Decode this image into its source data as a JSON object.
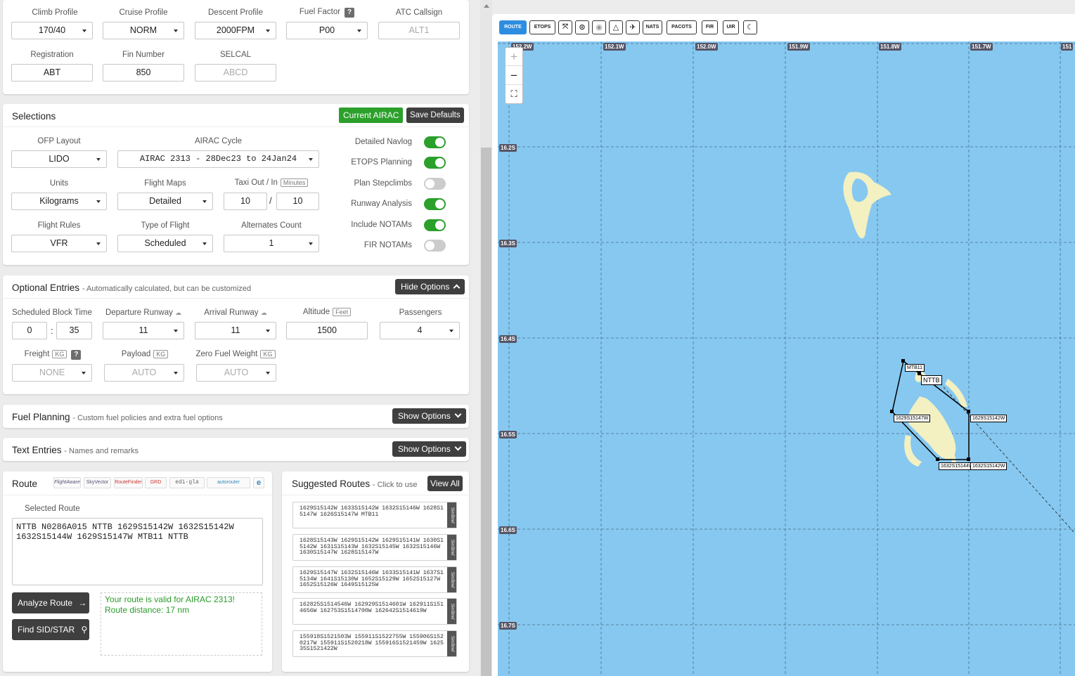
{
  "top": {
    "climb_label": "Climb Profile",
    "climb": "170/40",
    "cruise_label": "Cruise Profile",
    "cruise": "NORM",
    "descent_label": "Descent Profile",
    "descent": "2000FPM",
    "fuel_label": "Fuel Factor",
    "fuel_help": "?",
    "fuel": "P00",
    "atc_label": "ATC Callsign",
    "atc_placeholder": "ALT1",
    "reg_label": "Registration",
    "reg": "ABT",
    "fin_label": "Fin Number",
    "fin": "850",
    "selcal_label": "SELCAL",
    "selcal_placeholder": "ABCD"
  },
  "selections": {
    "title": "Selections",
    "current_airac": "Current AIRAC",
    "save_defaults": "Save Defaults",
    "ofp_label": "OFP Layout",
    "ofp": "LIDO",
    "airac_label": "AIRAC Cycle",
    "airac": "AIRAC 2313 - 28Dec23 to 24Jan24",
    "units_label": "Units",
    "units": "Kilograms",
    "maps_label": "Flight Maps",
    "maps": "Detailed",
    "taxi_label": "Taxi Out / In",
    "taxi_unit": "Minutes",
    "taxi_out": "10",
    "taxi_sep": "/",
    "taxi_in": "10",
    "rules_label": "Flight Rules",
    "rules": "VFR",
    "type_label": "Type of Flight",
    "type": "Scheduled",
    "alt_label": "Alternates Count",
    "alt": "1",
    "toggles": [
      {
        "label": "Detailed Navlog",
        "on": true
      },
      {
        "label": "ETOPS Planning",
        "on": true
      },
      {
        "label": "Plan Stepclimbs",
        "on": false
      },
      {
        "label": "Runway Analysis",
        "on": true
      },
      {
        "label": "Include NOTAMs",
        "on": true
      },
      {
        "label": "FIR NOTAMs",
        "on": false
      }
    ]
  },
  "optional": {
    "title": "Optional Entries",
    "subtitle": "- Automatically calculated, but can be customized",
    "hide_btn": "Hide Options",
    "block_label": "Scheduled Block Time",
    "block_h": "0",
    "block_sep": ":",
    "block_m": "35",
    "dep_label": "Departure Runway",
    "dep": "11",
    "arr_label": "Arrival Runway",
    "arr": "11",
    "altitude_label": "Altitude",
    "altitude_unit": "Feet",
    "altitude": "1500",
    "pax_label": "Passengers",
    "pax": "4",
    "freight_label": "Freight",
    "freight_unit": "KG",
    "freight_help": "?",
    "freight": "NONE",
    "payload_label": "Payload",
    "payload_unit": "KG",
    "payload": "AUTO",
    "zfw_label": "Zero Fuel Weight",
    "zfw_unit": "KG",
    "zfw": "AUTO"
  },
  "fuel_planning": {
    "title": "Fuel Planning",
    "subtitle": "- Custom fuel policies and extra fuel options",
    "btn": "Show Options"
  },
  "text_entries": {
    "title": "Text Entries",
    "subtitle": "- Names and remarks",
    "btn": "Show Options"
  },
  "route": {
    "title": "Route",
    "logos": [
      "FlightAware",
      "SkyVector",
      "RouteFinder",
      "GRD",
      "edi-gla",
      "autorouter",
      "e"
    ],
    "selected_label": "Selected Route",
    "route_text": "NTTB N0286A015 NTTB 1629S15142W 1632S15142W 1632S15144W 1629S15147W MTB11 NTTB",
    "analyze_btn": "Analyze Route",
    "find_btn": "Find SID/STAR",
    "valid_msg": "Your route is valid for AIRAC 2313!",
    "distance_msg": "Route distance: 17 nm"
  },
  "suggested": {
    "title": "Suggested Routes",
    "subtitle": "- Click to use",
    "view_all": "View All",
    "tab": "SimBrief",
    "routes": [
      "1629S15142W 1633S15142W 1632S15146W 1628S15147W 1626S15147W MTB11",
      "1628S15143W 1629S15142W 1629S15141W 1630S15142W 1631S15143W 1632S15145W 1632S15146W 1630S15147W 1628S15147W",
      "1629S15147W 1632S15146W 1633S15141W 1637S15134W 1641S15130W 1652S15129W 1652S15127W 1652S15126W 1649S15125W",
      "162825S1514546W 162929S1514601W 162911S1514656W 162753S1514700W 162642S1514619W",
      "155918S1521503W 155911S1522755W 155906S1520217W 155911S1520218W 155916S1521459W 162535S1521422W"
    ]
  },
  "map": {
    "toolbar": [
      "ROUTE",
      "ETOPS",
      "waypoints",
      "vor",
      "ndb",
      "airports",
      "navaids",
      "NATS",
      "PACOTS",
      "FIR",
      "UIR",
      "night"
    ],
    "lon_labels": [
      "152.2W",
      "152.1W",
      "152.0W",
      "151.9W",
      "151.8W",
      "151.7W",
      "151"
    ],
    "lat_labels": [
      "16.2S",
      "16.3S",
      "16.4S",
      "16.5S",
      "16.6S",
      "16.7S"
    ],
    "zoom_in": "+",
    "zoom_out": "−",
    "waypoints": [
      "MTB11",
      "NTTB",
      "1629S15147W",
      "1629S15142W",
      "1632S15144W",
      "1632S15142W"
    ],
    "colors": {
      "sea": "#86c8f0",
      "land": "#f3f0c2",
      "accent": "#2ba02b"
    }
  }
}
